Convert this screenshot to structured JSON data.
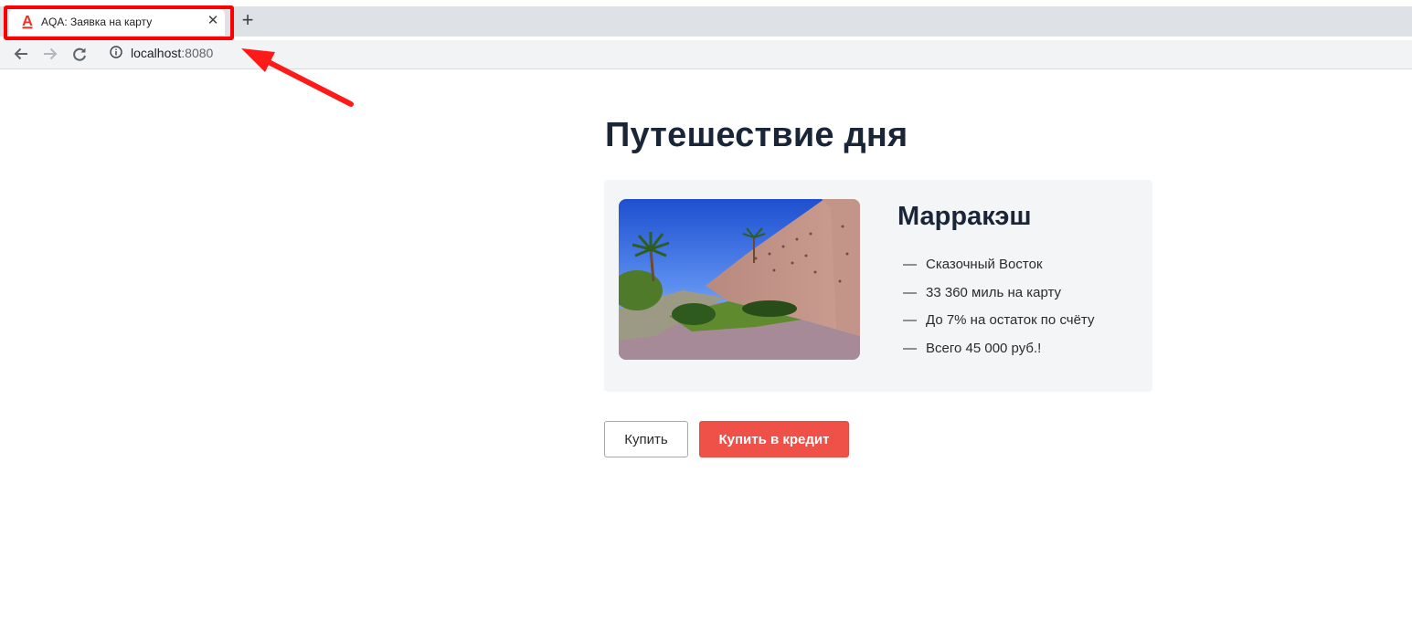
{
  "browser": {
    "tab_title": "AQA: Заявка на карту",
    "new_tab_label": "+",
    "close_label": "✕",
    "url_host": "localhost",
    "url_port": ":8080"
  },
  "page": {
    "title": "Путешествие дня",
    "offer": {
      "city": "Марракэш",
      "features": [
        "Сказочный Восток",
        "33 360 миль на карту",
        "До 7% на остаток по счёту",
        "Всего 45 000 руб.!"
      ],
      "dash": "—"
    },
    "buttons": {
      "buy": "Купить",
      "credit": "Купить в кредит"
    }
  },
  "colors": {
    "accent": "#ef5047",
    "annotation": "#ff0000",
    "heading": "#1a2538",
    "card_bg": "#f4f5f7"
  }
}
